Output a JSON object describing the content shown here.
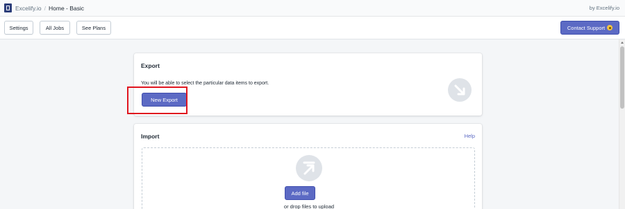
{
  "header": {
    "app_name": "Excelify.io",
    "separator": "/",
    "page": "Home - Basic",
    "by_label": "by Excelify.io"
  },
  "toolbar": {
    "buttons": [
      "Settings",
      "All Jobs",
      "See Plans"
    ],
    "contact_label": "Contact Support",
    "contact_icon": "lock-icon"
  },
  "export": {
    "title": "Export",
    "description": "You will be able to select the particular data items to export.",
    "button": "New Export",
    "icon": "export-arrow-icon"
  },
  "import": {
    "title": "Import",
    "help": "Help",
    "button": "Add file",
    "hint": "or drop files to upload",
    "icon": "import-arrow-icon"
  },
  "colors": {
    "primary": "#5c6ac4",
    "highlight": "#e0141e",
    "background": "#f4f6f8"
  }
}
